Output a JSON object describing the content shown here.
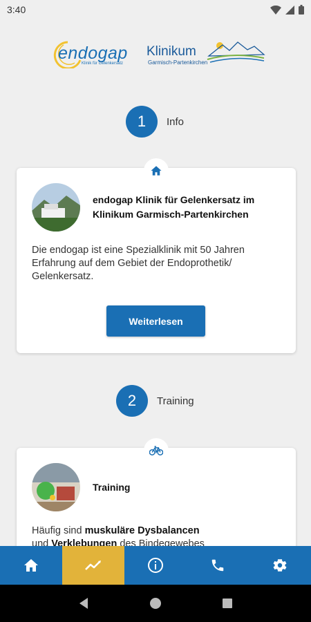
{
  "status": {
    "time": "3:40"
  },
  "logos": {
    "endogap_name": "endogap",
    "endogap_tagline": "Klinik für Gelenkersatz",
    "klinikum_name": "Klinikum",
    "klinikum_tagline": "Garmisch-Partenkirchen"
  },
  "steps": [
    {
      "number": "1",
      "label": "Info",
      "badge_icon": "home-icon",
      "card": {
        "title": "endogap Klinik für Gelenkersatz im Klinikum Garmisch-Partenkirchen",
        "text": "Die endogap ist eine Spezialklinik mit 50 Jahren Erfahrung auf dem Gebiet der Endoprothetik/ Gelenkersatz.",
        "button_label": "Weiterlesen"
      }
    },
    {
      "number": "2",
      "label": "Training",
      "badge_icon": "bicycle-icon",
      "card": {
        "title": "Training",
        "text_intro": "Häufig sind ",
        "text_bold1": "muskuläre Dysbalancen",
        "text_line2_start": "und ",
        "text_bold2": "Verklebungen",
        "text_line2_end": " des Bindegewebes"
      }
    }
  ],
  "bottom_nav": {
    "items": [
      {
        "icon": "home-icon",
        "active": false
      },
      {
        "icon": "chart-line-icon",
        "active": true
      },
      {
        "icon": "info-icon",
        "active": false
      },
      {
        "icon": "phone-icon",
        "active": false
      },
      {
        "icon": "gear-icon",
        "active": false
      }
    ],
    "active_color": "#e2b33a",
    "bar_color": "#1a6fb4"
  }
}
